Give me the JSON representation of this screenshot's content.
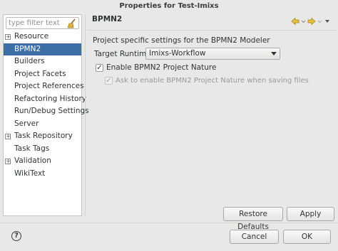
{
  "window": {
    "title": "Properties for Test-Imixs"
  },
  "filter": {
    "placeholder": "type filter text",
    "value": ""
  },
  "tree": {
    "items": [
      {
        "label": "Resource",
        "expandable": true,
        "selected": false
      },
      {
        "label": "BPMN2",
        "expandable": false,
        "selected": true
      },
      {
        "label": "Builders",
        "expandable": false,
        "selected": false
      },
      {
        "label": "Project Facets",
        "expandable": false,
        "selected": false
      },
      {
        "label": "Project References",
        "expandable": false,
        "selected": false
      },
      {
        "label": "Refactoring History",
        "expandable": false,
        "selected": false
      },
      {
        "label": "Run/Debug Settings",
        "expandable": false,
        "selected": false
      },
      {
        "label": "Server",
        "expandable": false,
        "selected": false
      },
      {
        "label": "Task Repository",
        "expandable": true,
        "selected": false
      },
      {
        "label": "Task Tags",
        "expandable": false,
        "selected": false
      },
      {
        "label": "Validation",
        "expandable": true,
        "selected": false
      },
      {
        "label": "WikiText",
        "expandable": false,
        "selected": false
      }
    ]
  },
  "page": {
    "title": "BPMN2",
    "description": "Project specific settings for the BPMN2 Modeler",
    "runtime_label": "Target Runtime",
    "runtime_value": "Imixs-Workflow",
    "enable_nature_label": "Enable BPMN2 Project Nature",
    "enable_nature_checked": true,
    "ask_nature_label": "Ask to enable BPMN2 Project Nature when saving files",
    "ask_nature_checked": true
  },
  "buttons": {
    "restore_defaults": "Restore Defaults",
    "apply": "Apply",
    "cancel": "Cancel",
    "ok": "OK"
  },
  "icons": {
    "back": "arrow-back-icon",
    "forward": "arrow-forward-icon",
    "menu": "view-menu-icon",
    "help": "help-icon",
    "clear_filter": "broom-icon"
  },
  "colors": {
    "selection": "#3d6fa6",
    "nav_arrow": "#d9a72a"
  }
}
